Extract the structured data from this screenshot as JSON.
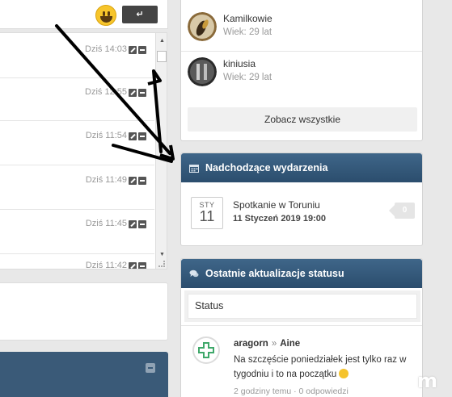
{
  "shoutbox": {
    "send_label": "↵",
    "rows": [
      {
        "time": "Dziś 14:03"
      },
      {
        "time": "Dziś 12:55"
      },
      {
        "time": "Dziś 11:54"
      },
      {
        "time": "Dziś 11:49"
      },
      {
        "time": "Dziś 11:45"
      },
      {
        "time": "Dziś 11:42"
      }
    ]
  },
  "friends": {
    "items": [
      {
        "name": "Kamilkowie",
        "age": "Wiek: 29 lat"
      },
      {
        "name": "kiniusia",
        "age": "Wiek: 29 lat"
      }
    ],
    "see_all": "Zobacz wszystkie"
  },
  "events": {
    "title": "Nadchodzące wydarzenia",
    "month": "STY",
    "day": "11",
    "event_title": "Spotkanie w Toruniu",
    "event_date": "11 Styczeń 2019 19:00",
    "count": "0"
  },
  "status": {
    "title": "Ostatnie aktualizacje statusu",
    "input_value": "Status",
    "author": "aragorn",
    "target": "Aine",
    "text": "Na szczęście poniedziałek jest tylko raz w tygodniu i to na początku",
    "meta": "2 godziny temu · 0 odpowiedzi"
  },
  "colors": {
    "header_blue": "#2f5272",
    "accent_green": "#3fa86a"
  }
}
